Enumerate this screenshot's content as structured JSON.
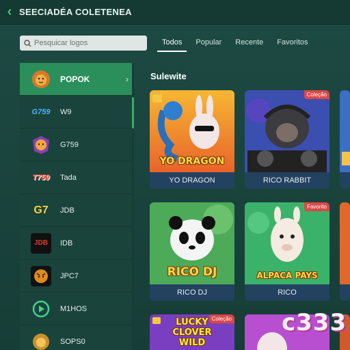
{
  "header": {
    "title": "SEECIADÉA COLETENEA",
    "back_icon": "chevron-left-icon"
  },
  "search": {
    "placeholder": "Pesquicar logos"
  },
  "tabs": [
    {
      "label": "Todos",
      "active": true
    },
    {
      "label": "Popular",
      "active": false
    },
    {
      "label": "Recente",
      "active": false
    },
    {
      "label": "Favoritos",
      "active": false
    }
  ],
  "sidebar": {
    "items": [
      {
        "label": "POPOK",
        "icon": "lion-icon",
        "active": true
      },
      {
        "label": "W9",
        "icon": "g759-logo-icon",
        "active": false
      },
      {
        "label": "G759",
        "icon": "lion-badge-icon",
        "active": false
      },
      {
        "label": "Tada",
        "icon": "t759-logo-icon",
        "active": false
      },
      {
        "label": "JDB",
        "icon": "g7-logo-icon",
        "active": false
      },
      {
        "label": "IDB",
        "icon": "jdb-logo-icon",
        "active": false
      },
      {
        "label": "JPC7",
        "icon": "tiger-icon",
        "active": false
      },
      {
        "label": "M1HOS",
        "icon": "play-circle-icon",
        "active": false
      },
      {
        "label": "SOPS0",
        "icon": "lion-small-icon",
        "active": false
      }
    ]
  },
  "main": {
    "section_title": "Sulewite",
    "cards": [
      {
        "caption": "YO DRAGON",
        "art_title": "YO DRAGON",
        "badge": ""
      },
      {
        "caption": "RICO RABBIT",
        "art_title": "",
        "badge": "Coleção"
      },
      {
        "caption": "RICO DJ",
        "art_title": "RICO DJ",
        "badge": ""
      },
      {
        "caption": "RICO",
        "art_title": "ALPACA PAYS",
        "badge": "Favorito"
      },
      {
        "caption": "",
        "art_title": "LUCKY CLOVER WILD",
        "badge": "Coleção"
      }
    ]
  },
  "watermark": "c333",
  "colors": {
    "accent": "#2a8f5a",
    "background": "#1d4a43",
    "badge": "#d94848",
    "caption_bar": "#23425f"
  }
}
